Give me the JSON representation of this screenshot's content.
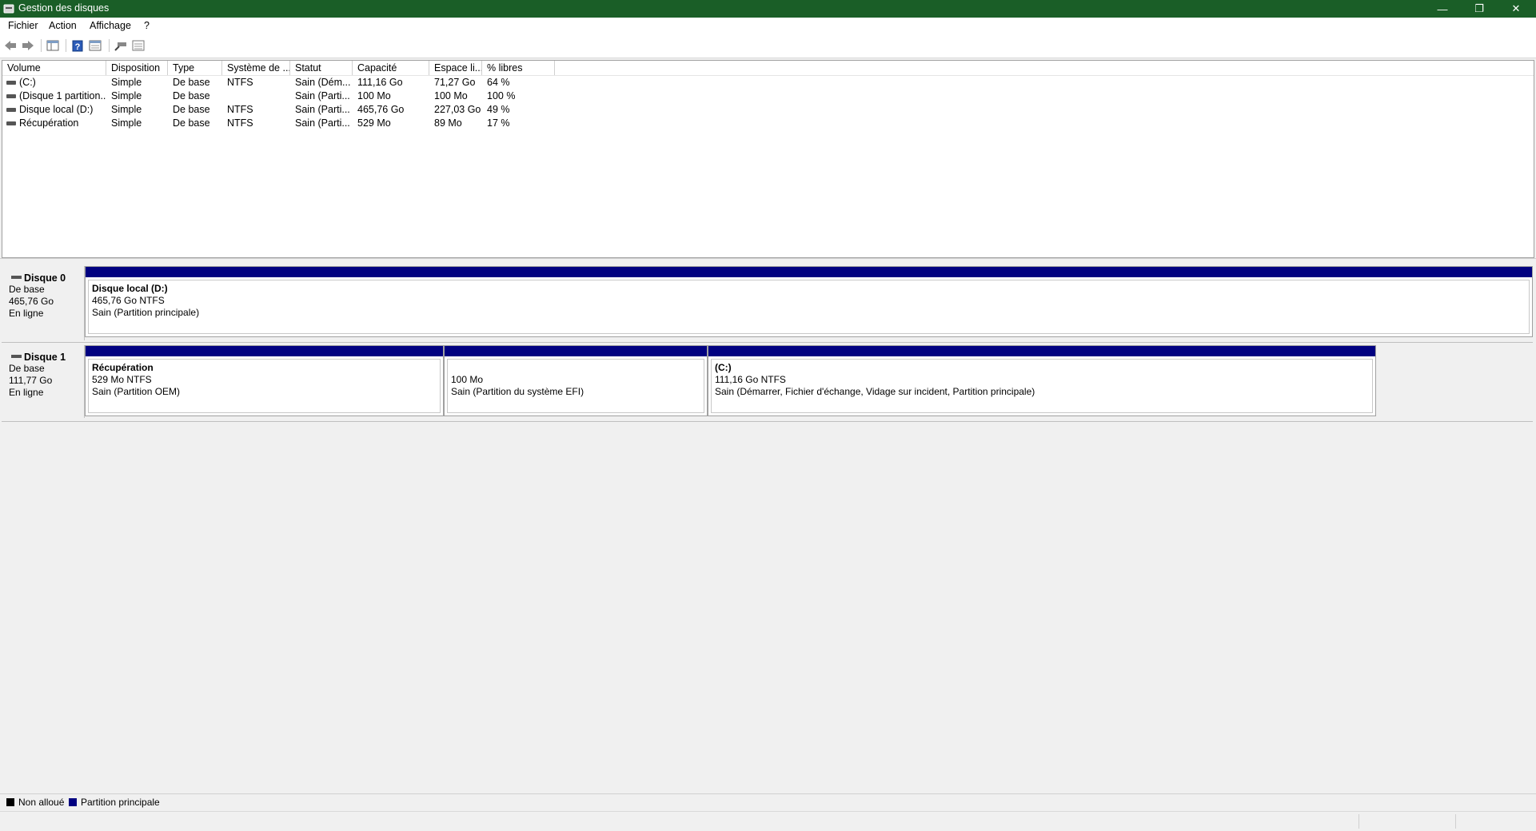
{
  "window": {
    "title": "Gestion des disques",
    "minimize": "—",
    "restore": "❐",
    "close": "✕"
  },
  "menu": {
    "items": [
      "Fichier",
      "Action",
      "Affichage",
      "?"
    ]
  },
  "toolbar": {
    "icons": [
      "back-icon",
      "forward-icon",
      "console-tree-icon",
      "help-icon",
      "properties-icon",
      "rescan-icon",
      "list-view-icon"
    ]
  },
  "volume_list": {
    "columns": [
      "Volume",
      "Disposition",
      "Type",
      "Système de ...",
      "Statut",
      "Capacité",
      "Espace li...",
      "% libres"
    ],
    "rows": [
      [
        "(C:)",
        "Simple",
        "De base",
        "NTFS",
        "Sain (Dém...",
        "111,16 Go",
        "71,27 Go",
        "64 %"
      ],
      [
        "(Disque 1 partition...",
        "Simple",
        "De base",
        "",
        "Sain (Parti...",
        "100 Mo",
        "100 Mo",
        "100 %"
      ],
      [
        "Disque local (D:)",
        "Simple",
        "De base",
        "NTFS",
        "Sain (Parti...",
        "465,76 Go",
        "227,03 Go",
        "49 %"
      ],
      [
        "Récupération",
        "Simple",
        "De base",
        "NTFS",
        "Sain (Parti...",
        "529 Mo",
        "89 Mo",
        "17 %"
      ]
    ]
  },
  "disks": [
    {
      "name": "Disque 0",
      "type": "De base",
      "size": "465,76 Go",
      "status": "En ligne",
      "partitions": [
        {
          "title": "Disque local  (D:)",
          "size": "465,76 Go NTFS",
          "status": "Sain (Partition principale)"
        }
      ]
    },
    {
      "name": "Disque 1",
      "type": "De base",
      "size": "111,77 Go",
      "status": "En ligne",
      "partitions": [
        {
          "title": "Récupération",
          "size": "529 Mo NTFS",
          "status": "Sain (Partition OEM)"
        },
        {
          "title": "",
          "size": "100 Mo",
          "status": "Sain (Partition du système EFI)"
        },
        {
          "title": "(C:)",
          "size": "111,16 Go NTFS",
          "status": "Sain (Démarrer, Fichier d'échange, Vidage sur incident, Partition principale)"
        }
      ]
    }
  ],
  "legend": {
    "unallocated": "Non alloué",
    "primary": "Partition principale",
    "unallocated_color": "#000000",
    "primary_color": "#000080"
  },
  "colors": {
    "titlebar": "#1a5e27",
    "partition_bar": "#000080"
  }
}
